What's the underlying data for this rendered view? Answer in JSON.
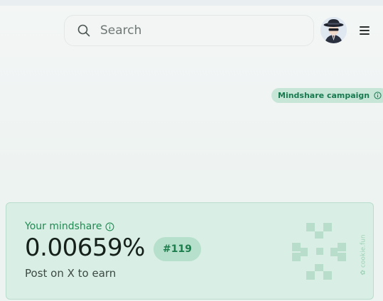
{
  "search": {
    "placeholder": "Search",
    "icon": "search-icon"
  },
  "header": {
    "avatar_alt": "User avatar",
    "menu_icon": "hamburger-menu-icon"
  },
  "campaign_badge": {
    "label": "Mindshare campaign",
    "icon": "info-icon"
  },
  "mindshare_card": {
    "label": "Your mindshare",
    "value": "0.00659%",
    "rank": "#119",
    "subtitle": "Post on X to earn",
    "brand": "cookie.fun"
  },
  "colors": {
    "accent_green": "#1f8a52",
    "card_bg": "#d9efe5",
    "badge_bg": "#c7e6d8"
  }
}
